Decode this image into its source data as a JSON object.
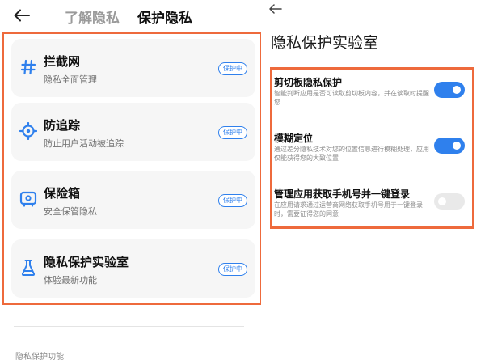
{
  "left": {
    "tabs": [
      {
        "label": "了解隐私",
        "active": false
      },
      {
        "label": "保护隐私",
        "active": true
      }
    ],
    "cards": [
      {
        "title": "拦截网",
        "subtitle": "隐私全面管理",
        "badge": "保护中",
        "icon": "hash-icon"
      },
      {
        "title": "防追踪",
        "subtitle": "防止用户活动被追踪",
        "badge": "保护中",
        "icon": "target-icon"
      },
      {
        "title": "保险箱",
        "subtitle": "安全保管隐私",
        "badge": "保护中",
        "icon": "safe-icon"
      },
      {
        "title": "隐私保护实验室",
        "subtitle": "体验最新功能",
        "badge": "保护中",
        "icon": "flask-icon"
      }
    ],
    "section_label": "隐私保护功能"
  },
  "right": {
    "title": "隐私保护实验室",
    "settings": [
      {
        "title": "剪切板隐私保护",
        "description": "智能判断应用是否可读取剪切板内容，并在读取时提醒您",
        "enabled": true
      },
      {
        "title": "模糊定位",
        "description": "通过差分隐私技术对您的位置信息进行模糊处理，应用仅能获得您的大致位置",
        "enabled": true
      },
      {
        "title": "管理应用获取手机号并一键登录",
        "description": "在应用请求通过运营商网络获取手机号用于一键登录时，需要征得您的同意",
        "enabled": false
      }
    ]
  },
  "colors": {
    "accent": "#2f80ed",
    "highlight_border": "#ee6a3c",
    "card_background": "#f6f6f6"
  }
}
